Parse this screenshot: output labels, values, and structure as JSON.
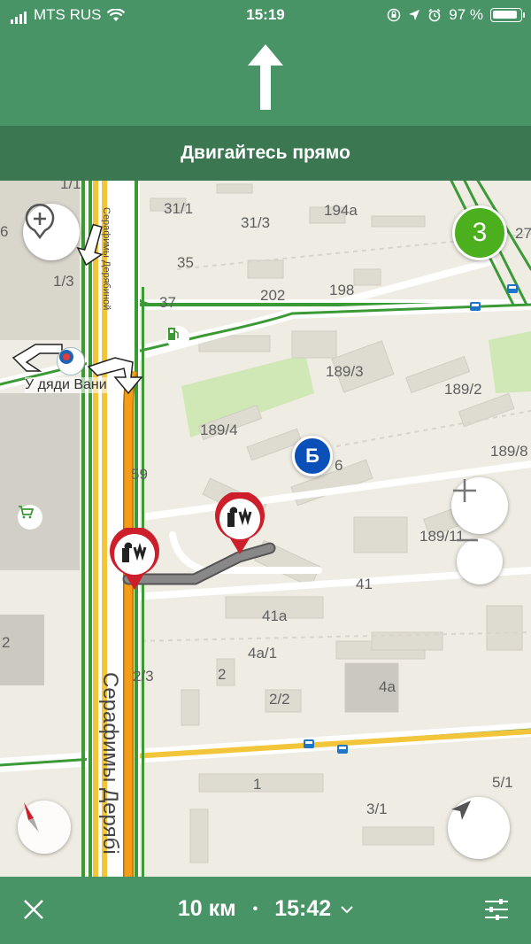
{
  "status_bar": {
    "carrier": "MTS RUS",
    "time": "15:19",
    "battery": "97 %"
  },
  "navigation": {
    "instruction": "Двигайтесь прямо"
  },
  "map": {
    "street_main": "Серафимы Дерябі",
    "street_small": "Серафимы Дерябиной",
    "poi_name": "У дяди Вани",
    "lane_count": "3",
    "bus_stop_badge": "Б",
    "labels": [
      "1/1",
      "31/1",
      "31/3",
      "194а",
      "35",
      "1/3",
      "37",
      "202",
      "198",
      "189/3",
      "189/2",
      "189/4",
      "6",
      "189/8",
      "189/11",
      "59",
      "41",
      "41а",
      "4а/1",
      "2",
      "2/3",
      "2/2",
      "4а",
      "1",
      "3/1",
      "5/1",
      "27",
      "6",
      "2"
    ]
  },
  "bottom_bar": {
    "distance": "10 км",
    "separator": "•",
    "arrival_time": "15:42"
  },
  "colors": {
    "header_green": "#489466",
    "instruction_green": "#3b7852",
    "route_orange": "#f59d16",
    "road_green": "#3b9a36",
    "lane_badge": "#4caf1e",
    "bus_badge": "#0b4fb8"
  },
  "icons": {
    "wifi": "wifi-icon",
    "location": "location-arrow-icon",
    "alarm": "alarm-icon",
    "lock": "orientation-lock-icon",
    "straight": "straight-arrow-icon",
    "add_place": "add-place-icon",
    "compass": "compass-icon",
    "zoom_in": "plus-icon",
    "zoom_out": "minus-icon",
    "my_location": "navigation-arrow-icon",
    "close": "close-icon",
    "settings": "sliders-icon"
  }
}
